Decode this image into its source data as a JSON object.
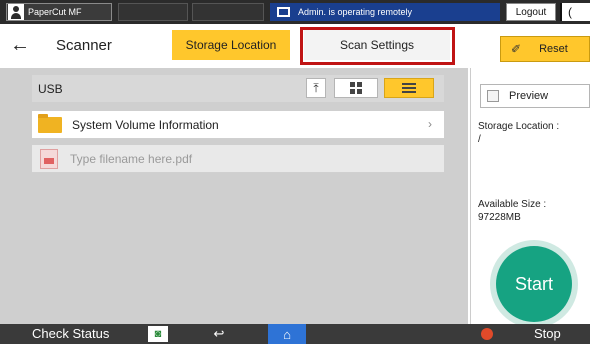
{
  "topbar": {
    "user_name": "PaperCut MF",
    "remote_status": "Admin. is operating remotely",
    "logout_label": "Logout",
    "moon_glyph": "("
  },
  "header": {
    "back_glyph": "←",
    "title": "Scanner",
    "tabs": [
      {
        "label": "Storage Location",
        "active": true
      },
      {
        "label": "Scan Settings",
        "active": false
      }
    ],
    "reset_label": "Reset",
    "reset_icon": "eraser-icon"
  },
  "browser": {
    "location": "USB",
    "view_buttons": [
      {
        "name": "upload-icon",
        "glyph": "⤒"
      },
      {
        "name": "grid-view-icon"
      },
      {
        "name": "list-view-icon",
        "active": true
      }
    ],
    "items": [
      {
        "type": "folder",
        "label": "System Volume Information",
        "chevron": "›"
      },
      {
        "type": "file",
        "placeholder": "Type filename here.pdf"
      }
    ]
  },
  "side_panel": {
    "preview_label": "Preview",
    "storage_location_label": "Storage Location :",
    "storage_location_value": "/",
    "available_size_label": "Available Size :",
    "available_size_value": "97228MB",
    "start_label": "Start"
  },
  "bottombar": {
    "check_status_label": "Check Status",
    "stop_label": "Stop",
    "back_glyph": "↩",
    "home_glyph": "⌂",
    "status_glyph": "◙"
  },
  "colors": {
    "accent_yellow": "#ffc72c",
    "start_green": "#16a382",
    "remote_blue": "#1a3f8f",
    "home_blue": "#2e73d6",
    "highlight_red": "#c01414"
  }
}
